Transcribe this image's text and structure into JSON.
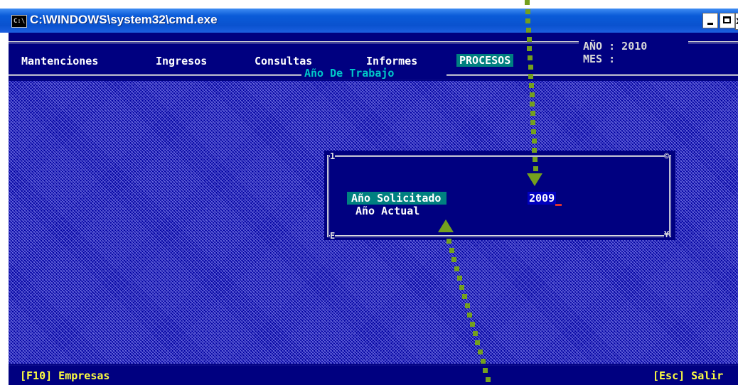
{
  "window": {
    "title": "C:\\WINDOWS\\system32\\cmd.exe",
    "icon_label": "C:\\",
    "min_glyph": "_",
    "close_glyph": "x"
  },
  "menu": {
    "items": [
      {
        "label": "Mantenciones",
        "active": false
      },
      {
        "label": "Ingresos",
        "active": false
      },
      {
        "label": "Consultas",
        "active": false
      },
      {
        "label": "Informes",
        "active": false
      },
      {
        "label": "PROCESOS",
        "active": true
      }
    ],
    "ano_label": "AÑO : 2010",
    "mes_label": "MES :",
    "subtitle": "Año De Trabajo"
  },
  "dialog": {
    "fields": [
      {
        "label": "Año Solicitado",
        "value": "2009",
        "selected": true
      },
      {
        "label": "Año Actual",
        "value": "",
        "selected": false
      }
    ],
    "corners": {
      "tl": "1",
      "tr": "©",
      "bl": "E",
      "br": "¥"
    }
  },
  "statusbar": {
    "left": "[F10] Empresas",
    "right": "[Esc] Salir"
  },
  "colors": {
    "console_bg": "#000080",
    "highlight": "#008080",
    "status_text": "#ffff40",
    "arrow": "#74a01e"
  }
}
